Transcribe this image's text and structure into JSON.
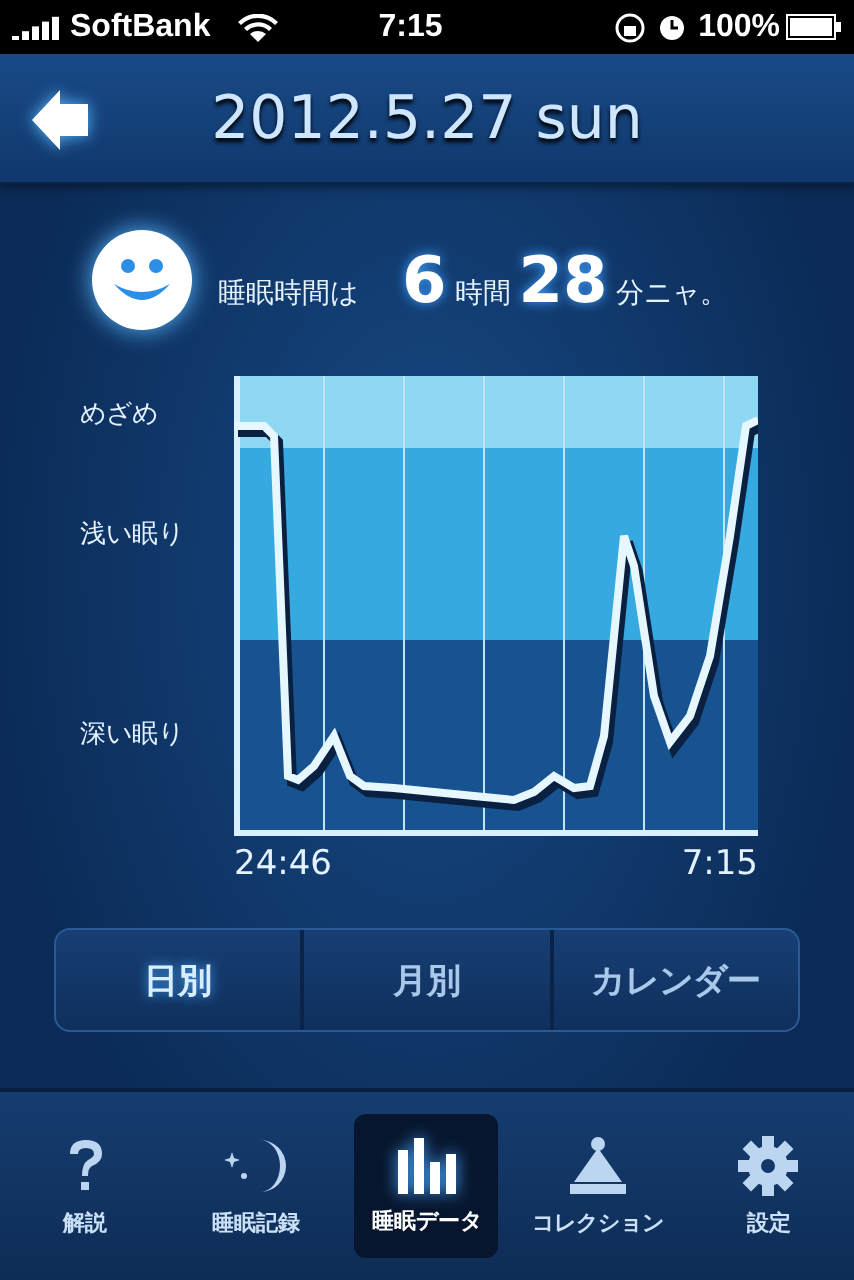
{
  "status_bar": {
    "carrier": "SoftBank",
    "time": "7:15",
    "battery": "100%"
  },
  "header": {
    "title": "2012.5.27 sun"
  },
  "summary": {
    "prefix": "睡眠時間は",
    "hours": "6",
    "hours_unit": "時間",
    "minutes": "28",
    "suffix": "分ニャ。"
  },
  "graph": {
    "levels": [
      "めざめ",
      "浅い眠り",
      "深い眠り"
    ],
    "start": "24:46",
    "end": "7:15"
  },
  "segments": [
    {
      "label": "日別",
      "selected": true
    },
    {
      "label": "月別",
      "selected": false
    },
    {
      "label": "カレンダー",
      "selected": false
    }
  ],
  "tabs": [
    {
      "label": "解説",
      "kind": "help",
      "selected": false
    },
    {
      "label": "睡眠記録",
      "kind": "moon",
      "selected": false
    },
    {
      "label": "睡眠データ",
      "kind": "bars",
      "selected": true
    },
    {
      "label": "コレクション",
      "kind": "hat",
      "selected": false
    },
    {
      "label": "設定",
      "kind": "gear",
      "selected": false
    }
  ]
}
